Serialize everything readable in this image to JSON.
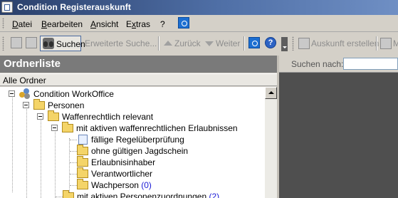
{
  "window": {
    "title": "Condition Registerauskunft"
  },
  "menu": {
    "items": [
      {
        "pre": "",
        "key": "D",
        "post": "atei"
      },
      {
        "pre": "",
        "key": "B",
        "post": "earbeiten"
      },
      {
        "pre": "",
        "key": "A",
        "post": "nsicht"
      },
      {
        "pre": "E",
        "key": "x",
        "post": "tras"
      },
      {
        "pre": "",
        "key": "?",
        "post": ""
      }
    ]
  },
  "toolbar": {
    "search": "Suchen",
    "advanced_search": "Erweiterte Suche...",
    "back": "Zurück",
    "forward": "Weiter",
    "create_report": "Auskunft erstellen",
    "overflow": "Mi",
    "help_glyph": "?"
  },
  "left_panel": {
    "header": "Ordnerliste",
    "subheader": "Alle Ordner",
    "tree": [
      {
        "label": "Condition WorkOffice",
        "count": ""
      },
      {
        "label": "Personen",
        "count": ""
      },
      {
        "label": "Waffenrechtlich relevant",
        "count": ""
      },
      {
        "label": "mit aktiven waffenrechtlichen Erlaubnissen",
        "count": ""
      },
      {
        "label": "fällige Regelüberprüfung",
        "count": ""
      },
      {
        "label": "ohne gültigen Jagdschein",
        "count": ""
      },
      {
        "label": "Erlaubnisinhaber",
        "count": ""
      },
      {
        "label": "Verantwortlicher",
        "count": ""
      },
      {
        "label": "Wachperson",
        "count": "(0)"
      },
      {
        "label": "mit aktiven Personenzuordnungen",
        "count": "(2)"
      }
    ]
  },
  "right_panel": {
    "search_label": "Suchen nach:",
    "search_value": "",
    "search_placeholder": ""
  },
  "colors": {
    "title_bar": "#2a3f6a",
    "panel_header": "#7a7a7a",
    "folder": "#f4d468",
    "count_text": "#1a1ad6",
    "content_area": "#4f4f4f"
  }
}
